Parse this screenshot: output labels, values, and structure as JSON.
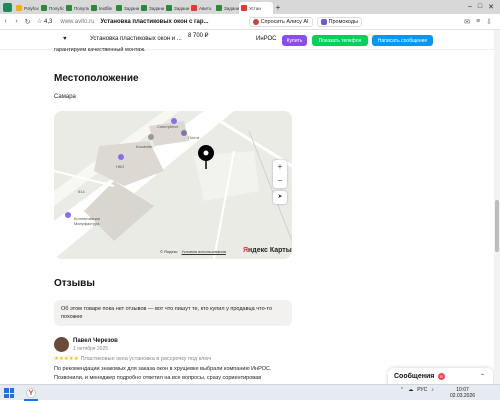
{
  "browser": {
    "tabs": [
      {
        "label": "Polyfox",
        "color": "#f5b000"
      },
      {
        "label": "Полубол",
        "color": "#2a8a3a"
      },
      {
        "label": "Попугай",
        "color": "#2a8a3a"
      },
      {
        "label": "textfile",
        "color": "#2a8a3a"
      },
      {
        "label": "Задани",
        "color": "#2a8a3a"
      },
      {
        "label": "Задани",
        "color": "#2a8a3a"
      },
      {
        "label": "Задани",
        "color": "#2a8a3a"
      },
      {
        "label": "Авито",
        "color": "#e33"
      },
      {
        "label": "Задани",
        "color": "#2a8a3a"
      },
      {
        "label": "Устан",
        "color": "#e33",
        "active": true
      }
    ],
    "rating": "4,3",
    "url": "www.avito.ru",
    "page_title": "Установка пластиковых окон с гар...",
    "alice_label": "Спросить Алису AI",
    "promo_label": "Промокоды"
  },
  "sticky_bar": {
    "title": "Установка пластиковых окон и ...",
    "price": "8 700 ₽",
    "seller": "ИнРОС",
    "buy_label": "Купить",
    "phone_label": "Показать телефон",
    "message_label": "Написать сообщение"
  },
  "description_tail": "гарантируем качественный монтаж.",
  "location": {
    "heading": "Местоположение",
    "city": "Самара",
    "labels": {
      "mall": "СпектрМол",
      "pochta": "Почта",
      "kosh": "Кошелёк",
      "ngo": "НКО",
      "manufactory": "Коллективная Мануфактура",
      "n514": "514"
    },
    "attribution": "© Яндекс",
    "terms": "Условия использования",
    "brand_red": "Я",
    "brand_rest": "ндекс Карты"
  },
  "reviews": {
    "heading": "Отзывы",
    "empty_text": "Об этом товаре пока нет отзывов — вот что пишут те, кто купил у продавца что-то похожее",
    "items": [
      {
        "name": "Павел Черезов",
        "date": "1 октября 2025",
        "stars": "★★★★★",
        "service": "Пластиковые окна установка в рассрочку под ключ",
        "text": "По рекомендации знакомых для заказа окон в хрущевке выбрали компанию ИнРОС. Позвонили, и менеджер подробно ответил на все вопросы, сразу сориентировав"
      }
    ]
  },
  "chat": {
    "label": "Сообщения",
    "badge": "6"
  },
  "taskbar": {
    "lang": "РУС",
    "time": "10:07",
    "date": "02.03.2026"
  }
}
